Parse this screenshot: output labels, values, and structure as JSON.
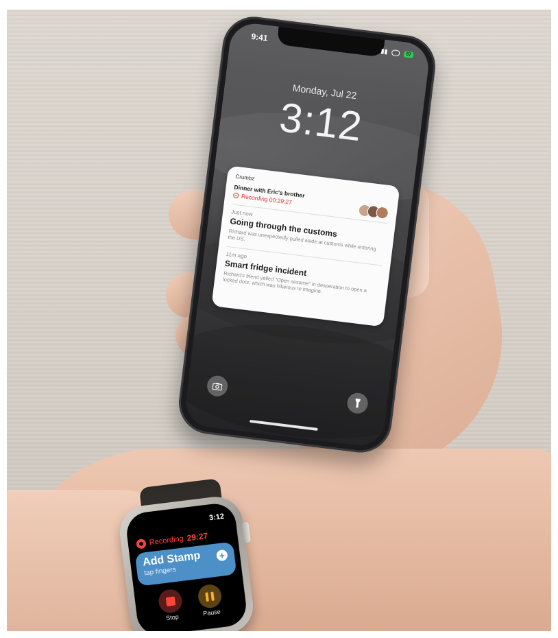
{
  "phone": {
    "status_time": "9:41",
    "battery": "87",
    "date": "Monday, Jul 22",
    "time": "3:12",
    "notification": {
      "app": "Crumbz",
      "title": "Dinner with Eric's brother",
      "recording": "Recording 00:29:27",
      "items": [
        {
          "meta": "Just now",
          "title": "Going through the customs",
          "body": "Richard was unexpectedly pulled aside at customs while entering the US."
        },
        {
          "meta": "11m ago",
          "title": "Smart fridge incident",
          "body": "Richard's friend yelled \"Open sesame\" in desperation to open a locked door, which was hilarious to imagine."
        }
      ]
    },
    "icons": {
      "camera": "camera-icon",
      "flashlight": "flashlight-icon"
    }
  },
  "watch": {
    "time": "3:12",
    "recording_label": "Recording",
    "recording_time": "29:27",
    "card_title": "Add Stamp",
    "card_subtitle": "tap fingers",
    "stop_label": "Stop",
    "pause_label": "Pause"
  },
  "colors": {
    "recording_red": "#ff453a",
    "card_blue": "#4d90c8",
    "pause_amber": "#ffb01f",
    "battery_green": "#34c759"
  }
}
